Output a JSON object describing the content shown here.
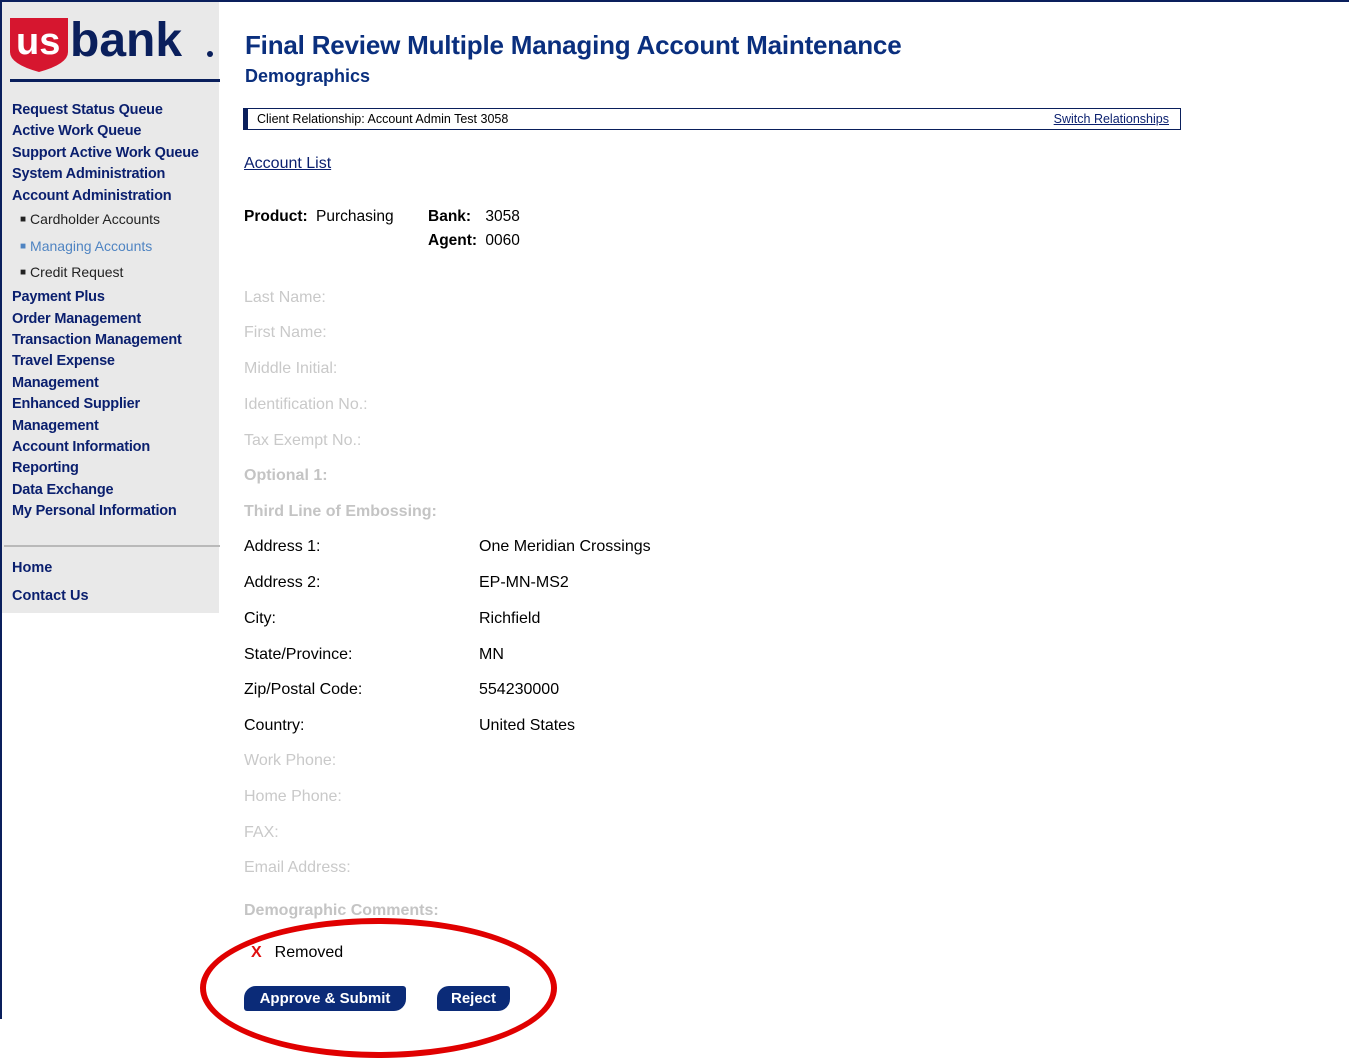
{
  "brand": {
    "logo_us": "us",
    "logo_bank": "bank",
    "accent": "#0a1f5c",
    "logo_red": "#d6162f"
  },
  "sidebar": {
    "items": [
      "Request Status Queue",
      "Active Work Queue",
      "Support Active Work Queue",
      "System Administration",
      "Account Administration"
    ],
    "sub_items": [
      "Cardholder Accounts",
      "Managing Accounts",
      "Credit Request"
    ],
    "items2": [
      "Payment Plus",
      "Order Management",
      "Transaction Management",
      "Travel Expense Management",
      "Enhanced Supplier Management",
      "Account Information",
      "Reporting",
      "Data Exchange",
      "My Personal Information"
    ],
    "bottom": [
      "Home",
      "Contact Us"
    ]
  },
  "header": {
    "title": "Final Review Multiple Managing Account Maintenance",
    "subtitle": "Demographics"
  },
  "relationship": {
    "label": "Client Relationship:  Account Admin Test 3058",
    "switch_link": "Switch Relationships"
  },
  "account_list_link": "Account List",
  "product": {
    "product_label": "Product:",
    "product_value": "Purchasing",
    "bank_label": "Bank:",
    "bank_value": "3058",
    "agent_label": "Agent:",
    "agent_value": "0060"
  },
  "fields": {
    "last_name": "Last Name:",
    "first_name": "First Name:",
    "middle_initial": "Middle Initial:",
    "identification": "Identification No.:",
    "tax_exempt": "Tax Exempt No.:",
    "optional1": "Optional 1:",
    "third_line": "Third Line of Embossing:",
    "address1": "Address 1:",
    "address2": "Address 2:",
    "city": "City:",
    "state": "State/Province:",
    "zip": "Zip/Postal Code:",
    "country": "Country:",
    "work_phone": "Work Phone:",
    "home_phone": "Home Phone:",
    "fax": "FAX:",
    "email": "Email Address:",
    "comments": "Demographic Comments:"
  },
  "values": {
    "address1": "One Meridian Crossings",
    "address2": "EP-MN-MS2",
    "city": "Richfield",
    "state": "MN",
    "zip": "554230000",
    "country": "United States"
  },
  "status": {
    "mark": "X",
    "text": "Removed"
  },
  "buttons": {
    "approve": "Approve & Submit",
    "reject": "Reject"
  }
}
